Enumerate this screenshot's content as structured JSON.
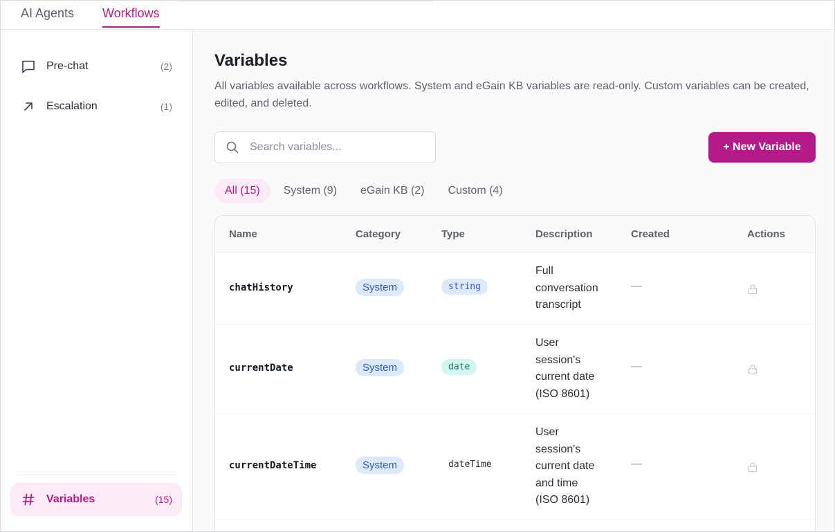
{
  "tabs": [
    {
      "label": "AI Agents",
      "active": false
    },
    {
      "label": "Workflows",
      "active": true
    }
  ],
  "sidebar": {
    "items": [
      {
        "label": "Pre-chat",
        "count": "(2)",
        "icon": "chat-bubble-icon"
      },
      {
        "label": "Escalation",
        "count": "(1)",
        "icon": "arrow-up-right-icon"
      }
    ],
    "footer": {
      "label": "Variables",
      "count": "(15)",
      "icon": "hash-icon",
      "active": true
    }
  },
  "page": {
    "title": "Variables",
    "description": "All variables available across workflows. System and eGain KB variables are read-only. Custom variables can be created, edited, and deleted."
  },
  "search": {
    "placeholder": "Search variables...",
    "value": ""
  },
  "new_button": "+ New Variable",
  "filters": [
    {
      "label": "All (15)",
      "active": true
    },
    {
      "label": "System (9)",
      "active": false
    },
    {
      "label": "eGain KB (2)",
      "active": false
    },
    {
      "label": "Custom (4)",
      "active": false
    }
  ],
  "table": {
    "headers": [
      "Name",
      "Category",
      "Type",
      "Description",
      "Created",
      "Actions"
    ],
    "rows": [
      {
        "name": "chatHistory",
        "category": "System",
        "type": "string",
        "description": [
          "Full",
          "conversation",
          "transcript"
        ],
        "created": "—",
        "action_icon": "lock-icon"
      },
      {
        "name": "currentDate",
        "category": "System",
        "type": "date",
        "description": [
          "User",
          "session's",
          "current date",
          "(ISO 8601)"
        ],
        "created": "—",
        "action_icon": "lock-icon"
      },
      {
        "name": "currentDateTime",
        "category": "System",
        "type": "dateTime",
        "description": [
          "User",
          "session's",
          "current date",
          "and time",
          "(ISO 8601)"
        ],
        "created": "—",
        "action_icon": "lock-icon"
      }
    ]
  },
  "colors": {
    "accent": "#b5198a",
    "accent_bg": "#fcebf6",
    "category_pill_bg": "#dde9fb",
    "type_string_bg": "#dde9fb",
    "type_date_bg": "#d3f5ef"
  }
}
